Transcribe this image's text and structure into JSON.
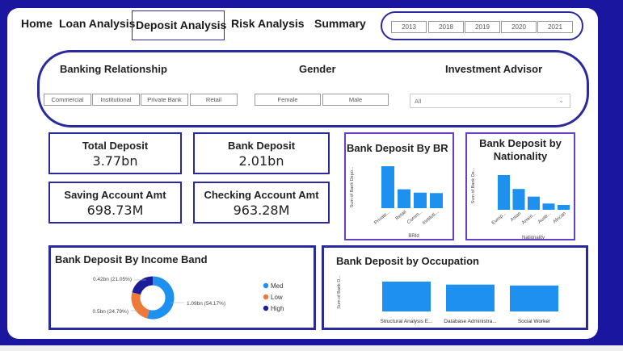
{
  "nav": {
    "items": [
      {
        "label": "Home"
      },
      {
        "label": "Loan Analysis"
      },
      {
        "label": "Deposit Analysis"
      },
      {
        "label": "Risk Analysis"
      },
      {
        "label": "Summary"
      }
    ],
    "active_index": 2
  },
  "years": [
    "2013",
    "2018",
    "2019",
    "2020",
    "2021"
  ],
  "slicers": {
    "banking_relationship": {
      "title": "Banking Relationship",
      "options": [
        "Commercial",
        "Institutional",
        "Private Bank",
        "Retail"
      ]
    },
    "gender": {
      "title": "Gender",
      "options": [
        "Female",
        "Male"
      ]
    },
    "investment_advisor": {
      "title": "Investment Advisor",
      "value": "All"
    }
  },
  "kpis": {
    "total_deposit": {
      "title": "Total Deposit",
      "value": "3.77bn"
    },
    "bank_deposit": {
      "title": "Bank Deposit",
      "value": "2.01bn"
    },
    "saving_account": {
      "title": "Saving Account Amt",
      "value": "698.73M"
    },
    "checking_account": {
      "title": "Checking Account Amt",
      "value": "963.28M"
    }
  },
  "colors": {
    "frame": "#1a16a0",
    "accent": "#2a2a9e",
    "bar": "#1e90f0",
    "med": "#1e90f0",
    "low": "#ee7a3a",
    "high": "#1c1c9a"
  },
  "chart_data": [
    {
      "type": "bar",
      "title": "Bank Deposit By BR",
      "xlabel": "BRId",
      "ylabel": "Sum of Bank Depo...",
      "categories": [
        "Private...",
        "Retail",
        "Comm...",
        "Instituti..."
      ],
      "values": [
        1.0,
        0.45,
        0.37,
        0.36
      ]
    },
    {
      "type": "bar",
      "title": "Bank Deposit by Nationality",
      "xlabel": "Nationality",
      "ylabel": "Sum of Bank De...",
      "categories": [
        "Europ...",
        "Asian",
        "Ameri...",
        "Austr...",
        "African"
      ],
      "values": [
        1.0,
        0.6,
        0.38,
        0.18,
        0.14
      ]
    },
    {
      "type": "pie",
      "title": "Bank Deposit By Income Band",
      "categories": [
        "Med",
        "Low",
        "High"
      ],
      "values": [
        1.09,
        0.5,
        0.42
      ],
      "data_labels": [
        "1.09bn (54.17%)",
        "0.5bn (24.79%)",
        "0.42bn (21.05%)"
      ],
      "legend": "right"
    },
    {
      "type": "bar",
      "title": "Bank Deposit by Occupation",
      "ylabel": "Sum of Bank D...",
      "categories": [
        "Structural Analysis E...",
        "Database Administra...",
        "Social Worker"
      ],
      "values": [
        1.0,
        0.9,
        0.87
      ]
    }
  ]
}
